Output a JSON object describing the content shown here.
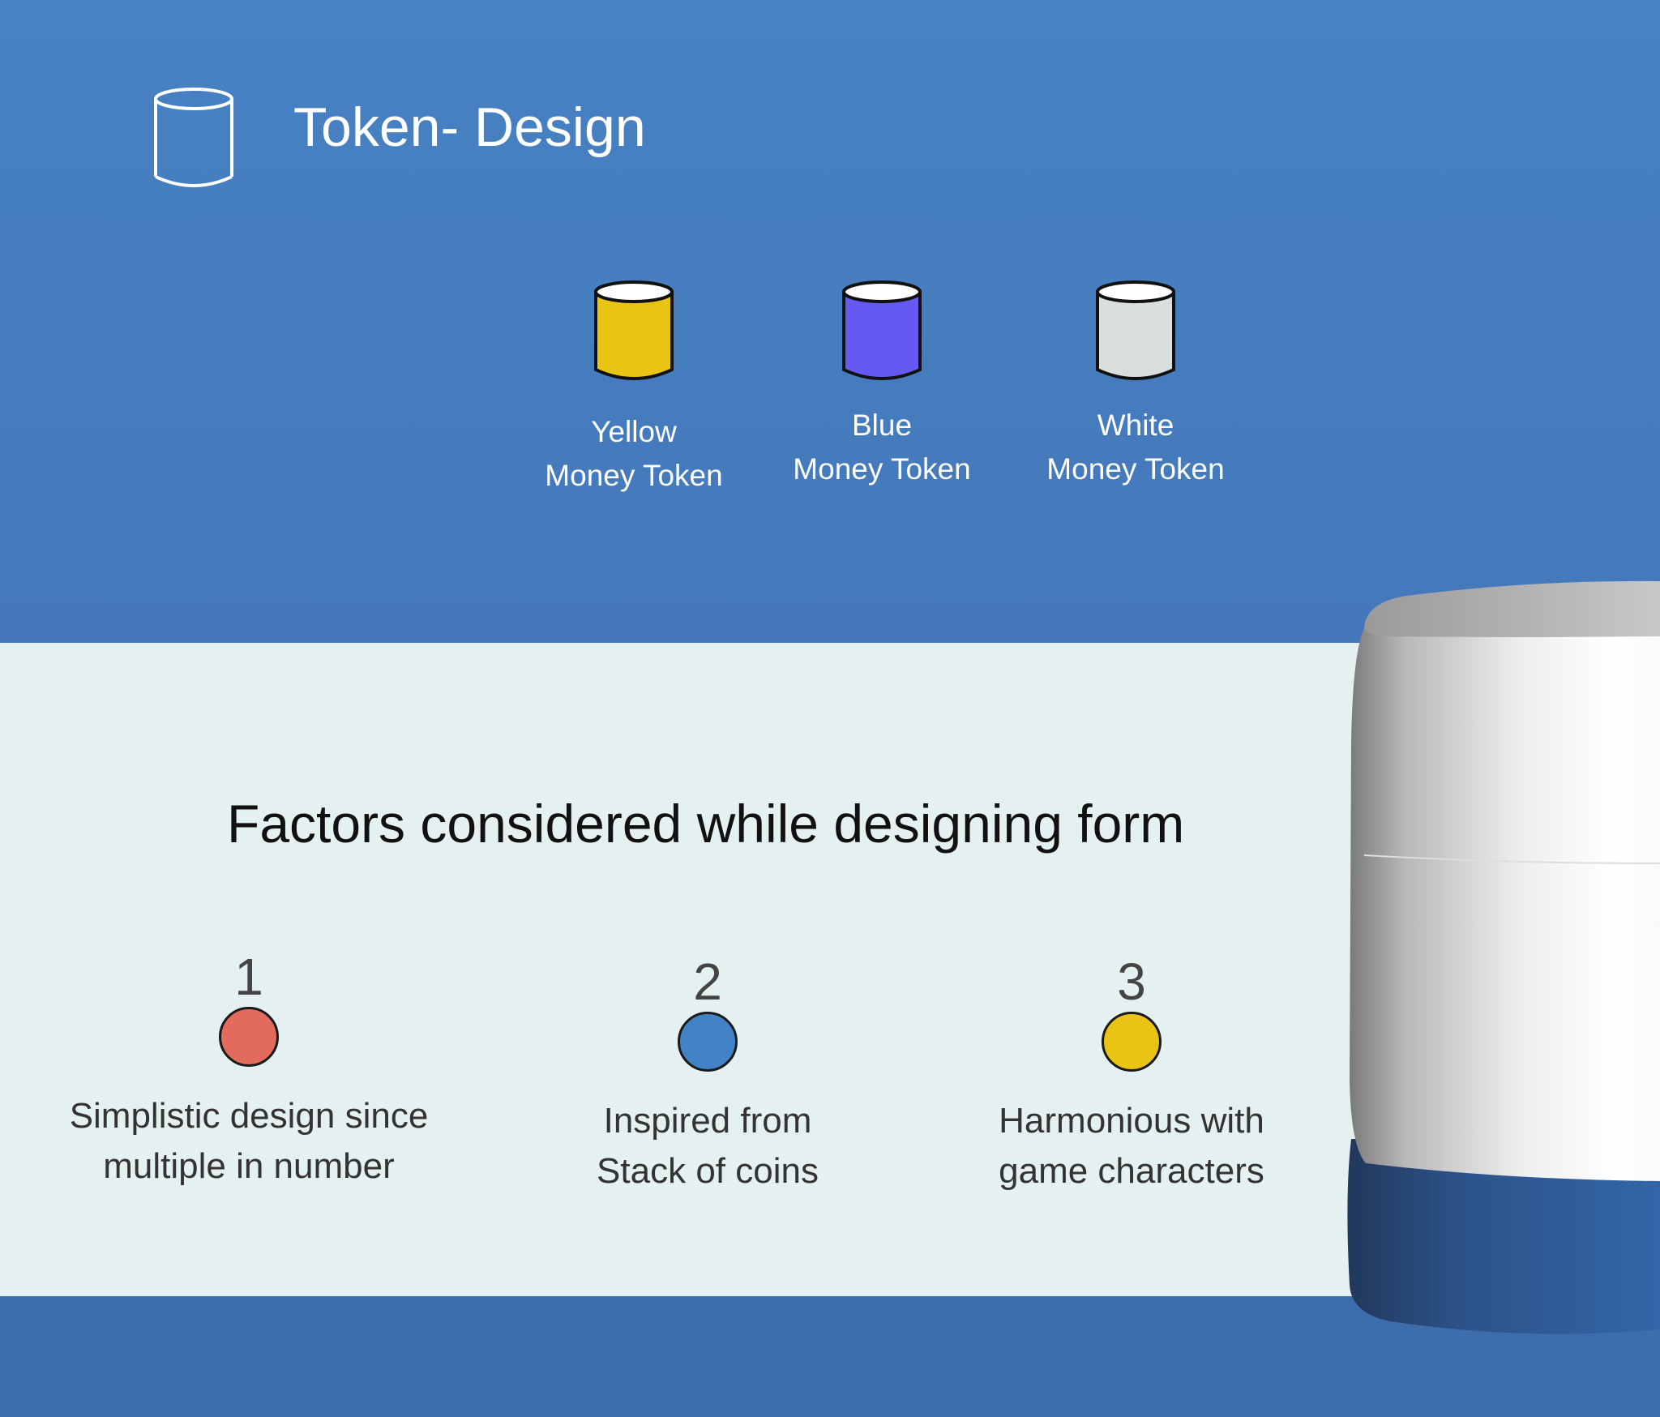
{
  "header": {
    "title": "Token- Design",
    "icon": "cylinder-outline-icon"
  },
  "tokens": [
    {
      "label_line1": "Yellow",
      "label_line2": "Money Token",
      "color": "#e9c414"
    },
    {
      "label_line1": "Blue",
      "label_line2": "Money Token",
      "color": "#6459f2"
    },
    {
      "label_line1": "White",
      "label_line2": "Money Token",
      "color": "#d9dfdd"
    }
  ],
  "factors": {
    "title": "Factors considered while designing form",
    "items": [
      {
        "number": "1",
        "color": "#e26b5d",
        "line1": "Simplistic design since",
        "line2": "multiple in number"
      },
      {
        "number": "2",
        "color": "#4283c7",
        "line1": "Inspired from",
        "line2": "Stack of coins"
      },
      {
        "number": "3",
        "color": "#e9c414",
        "line1": "Harmonious with",
        "line2": "game characters"
      }
    ]
  },
  "colors": {
    "top_background": "#4680c1",
    "middle_background": "#e5f1f0",
    "bottom_background": "#3e6dab",
    "render_body": "#f2f2f2",
    "render_base": "#2f5f9c"
  }
}
